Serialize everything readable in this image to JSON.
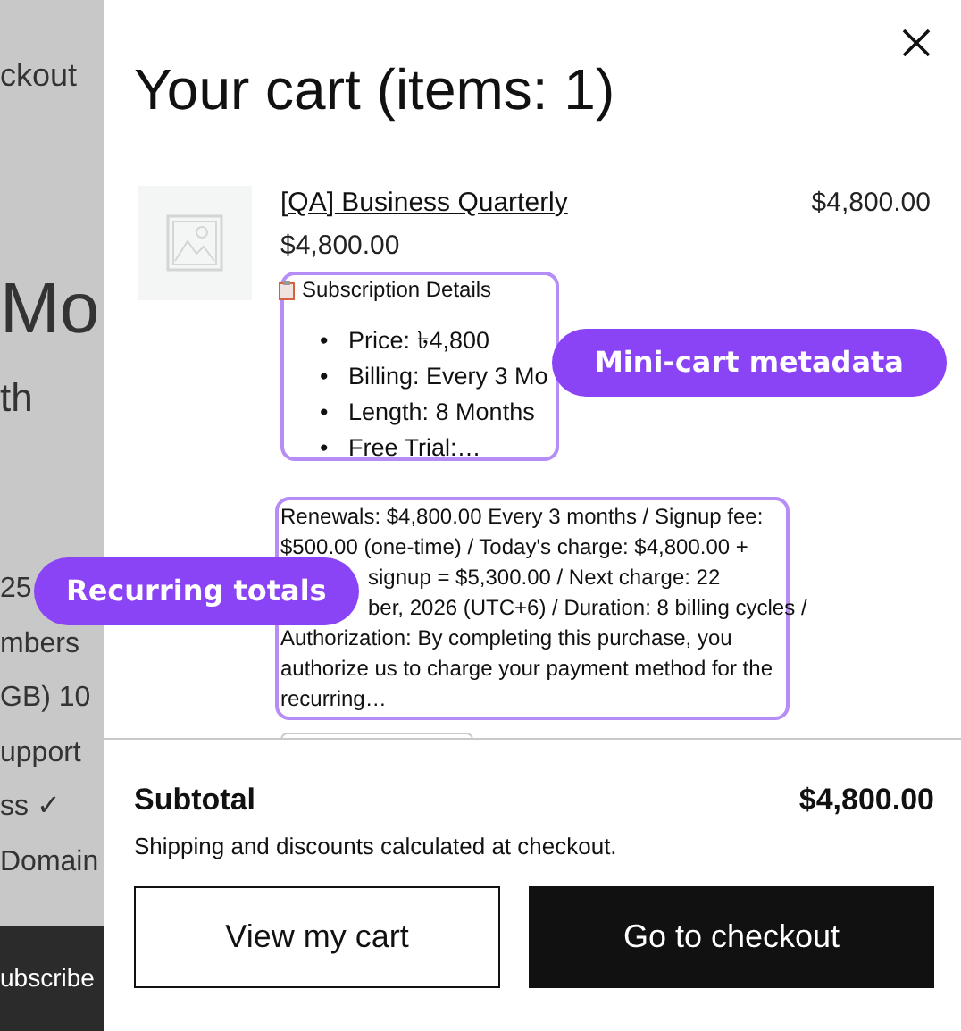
{
  "background_page": {
    "texts": [
      {
        "kind": "link",
        "text": "ckout"
      },
      {
        "kind": "heading",
        "text": "Mo"
      },
      {
        "kind": "subheading",
        "text": "th"
      },
      {
        "kind": "feature",
        "text": "25"
      },
      {
        "kind": "feature",
        "text": "mbers"
      },
      {
        "kind": "feature",
        "text": "GB) 10"
      },
      {
        "kind": "feature",
        "text": "upport"
      },
      {
        "kind": "feature",
        "text": "ss ✓"
      },
      {
        "kind": "feature",
        "text": "Domain"
      }
    ],
    "button": "ubscribe"
  },
  "cart": {
    "title": "Your cart (items: 1)",
    "items": [
      {
        "name": "[QA] Business Quarterly",
        "line_total": "$4,800.00",
        "price": "$4,800.00",
        "subscription_label": "Subscription Details",
        "details": [
          {
            "bullet": "•",
            "text": "Price: ৳4,800"
          },
          {
            "bullet": "•",
            "text": "Billing: Every 3 Mo"
          },
          {
            "bullet": "•",
            "text": "Length: 8 Months"
          },
          {
            "bullet": "•",
            "text": "Free Trial:…"
          }
        ],
        "renewal_lines": [
          {
            "indent": false,
            "text": "Renewals: $4,800.00 Every 3 months / Signup fee:"
          },
          {
            "indent": false,
            "text": "$500.00 (one-time) / Today's charge: $4,800.00 +"
          },
          {
            "indent": true,
            "text": "signup = $5,300.00 / Next charge: 22"
          },
          {
            "indent": true,
            "text": "ber, 2026 (UTC+6) / Duration: 8 billing cycles /"
          },
          {
            "indent": false,
            "text": "Authorization: By completing this purchase, you"
          },
          {
            "indent": false,
            "text": "authorize us to charge your payment method for the"
          },
          {
            "indent": false,
            "text": "recurring…"
          }
        ]
      }
    ],
    "subtotal_label": "Subtotal",
    "subtotal": "$4,800.00",
    "note": "Shipping and discounts calculated at checkout.",
    "buttons": [
      {
        "kind": "secondary",
        "label": "View my cart"
      },
      {
        "kind": "primary",
        "label": "Go to checkout"
      }
    ]
  },
  "annotations": [
    {
      "label": "Mini-cart metadata"
    },
    {
      "label": "Recurring totals"
    }
  ]
}
